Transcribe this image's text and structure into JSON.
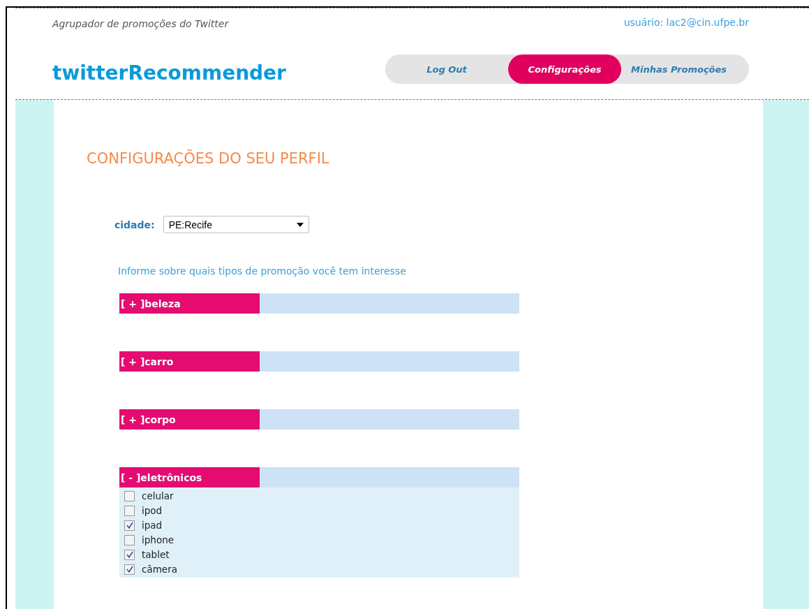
{
  "header": {
    "tagline": "Agrupador de promoções do Twitter",
    "user": "usuário: lac2@cin.ufpe.br",
    "logo": "twitterRecommender"
  },
  "nav": [
    {
      "label": "Log Out",
      "selected": false
    },
    {
      "label": "Configurações",
      "selected": true
    },
    {
      "label": "Minhas Promoções",
      "selected": false
    }
  ],
  "title": "CONFIGURAÇÕES DO SEU PERFIL",
  "city": {
    "label": "cidade:",
    "value": "PE:Recife"
  },
  "info": "Informe sobre quais tipos de promoção você tem interesse",
  "categories": [
    {
      "toggle": "[ + ]",
      "name": "beleza",
      "expanded": false
    },
    {
      "toggle": "[ + ]",
      "name": "carro",
      "expanded": false
    },
    {
      "toggle": "[ + ]",
      "name": "corpo",
      "expanded": false
    },
    {
      "toggle": "[ - ]",
      "name": "eletrônicos",
      "expanded": true,
      "options": [
        {
          "label": "celular",
          "checked": false
        },
        {
          "label": "ipod",
          "checked": false
        },
        {
          "label": "ipad",
          "checked": true
        },
        {
          "label": "iphone",
          "checked": false
        },
        {
          "label": "tablet",
          "checked": true
        },
        {
          "label": "câmera",
          "checked": true
        }
      ]
    }
  ]
}
